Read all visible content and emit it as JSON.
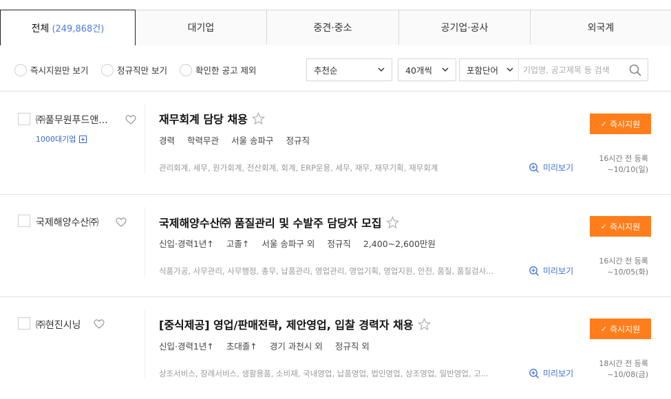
{
  "tabs": [
    {
      "label": "전체",
      "count": "(249,868건)"
    },
    {
      "label": "대기업"
    },
    {
      "label": "중견·중소"
    },
    {
      "label": "공기업·공사"
    },
    {
      "label": "외국계"
    }
  ],
  "filters": {
    "radio1": "즉시지원만 보기",
    "radio2": "정규직만 보기",
    "radio3": "확인한 공고 제외",
    "sort": "추천순",
    "per_page": "40개씩",
    "keyword_mode": "포함단어",
    "search_placeholder": "기업명, 공고제목 등 검색"
  },
  "jobs": [
    {
      "company": "㈜풀무원푸드앤...",
      "badge": "1000대기업",
      "title": "재무회계 담당 채용",
      "conds": [
        "경력",
        "학력무관",
        "서울 송파구",
        "정규직"
      ],
      "tags": "관리회계, 세무, 원가회계, 전산회계, 회계, ERP운용, 세무, 재무, 재무기획, 재무회계",
      "preview": "미리보기",
      "apply": "즉시지원",
      "reg1": "16시간 전 등록",
      "reg2": "~10/10(일)"
    },
    {
      "company": "국제해양수산㈜",
      "badge": "",
      "title": "국제해양수산㈜ 품질관리 및 수발주 담당자 모집",
      "conds": [
        "신입·경력1년↑",
        "고졸↑",
        "서울 송파구 외",
        "정규직",
        "2,400~2,600만원"
      ],
      "tags": "식품가공, 사무관리, 사무행정, 총무, 납품관리, 영업관리, 영업기획, 영업지원, 안전, 품질, 품질검사...",
      "preview": "미리보기",
      "apply": "즉시지원",
      "reg1": "16시간 전 등록",
      "reg2": "~10/05(화)"
    },
    {
      "company": "㈜현진시닝",
      "badge": "",
      "title": "[중식제공] 영업/판매전략, 제안영업, 입찰 경력자 채용",
      "conds": [
        "신입·경력1년↑",
        "초대졸↑",
        "경기 과천시 외",
        "정규직 외"
      ],
      "tags": "상조서비스, 장례서비스, 생활용품, 소비재, 국내영업, 납품영업, 법인영업, 상조영업, 일반영업, 고...",
      "preview": "미리보기",
      "apply": "즉시지원",
      "reg1": "18시간 전 등록",
      "reg2": "~10/08(금)"
    }
  ],
  "colors": {
    "accent": "#ff7e1b",
    "link": "#3b6fd8",
    "count": "#4a7cdd"
  }
}
